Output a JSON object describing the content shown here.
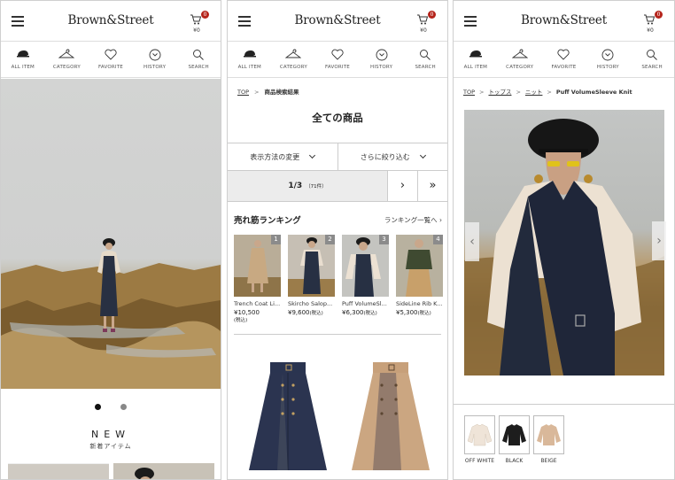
{
  "header": {
    "logo": "Brown&Street",
    "cart_badge": "0",
    "cart_amount": "¥0"
  },
  "icon_nav": [
    {
      "label": "ALL ITEM",
      "icon": "hat-icon"
    },
    {
      "label": "CATEGORY",
      "icon": "hanger-icon"
    },
    {
      "label": "FAVORITE",
      "icon": "heart-icon"
    },
    {
      "label": "HISTORY",
      "icon": "history-icon"
    },
    {
      "label": "SEARCH",
      "icon": "search-icon"
    }
  ],
  "home": {
    "new_title": "NEW",
    "new_subtitle": "新着アイテム",
    "slider_dots": 2,
    "active_dot": 0
  },
  "search": {
    "breadcrumb": [
      "TOP",
      "商品検索結果"
    ],
    "title": "全ての商品",
    "filter_display": "表示方法の変更",
    "filter_narrow": "さらに絞り込む",
    "pager_text": "1/3",
    "pager_count": "（71件）",
    "next": "›",
    "last": "»",
    "ranking_title": "売れ筋ランキング",
    "ranking_link": "ランキング一覧へ ›",
    "ranking": [
      {
        "rank": "1",
        "name": "Trench Coat Li...",
        "price": "¥10,500",
        "tax": "(税込)"
      },
      {
        "rank": "2",
        "name": "Skircho Salop...",
        "price": "¥9,600",
        "tax": "(税込)"
      },
      {
        "rank": "3",
        "name": "Puff VolumeSl...",
        "price": "¥6,300",
        "tax": "(税込)"
      },
      {
        "rank": "4",
        "name": "SideLine Rib K...",
        "price": "¥5,300",
        "tax": "(税込)"
      }
    ]
  },
  "product": {
    "breadcrumb": [
      "TOP",
      "トップス",
      "ニット",
      "Puff VolumeSleeve Knit"
    ],
    "prev": "‹",
    "next": "›",
    "colors": [
      {
        "label": "OFF WHITE",
        "color": "#efe4d8"
      },
      {
        "label": "BLACK",
        "color": "#1d1d1d"
      },
      {
        "label": "BEIGE",
        "color": "#d9b89a"
      }
    ]
  },
  "colors": {
    "accent_badge": "#b5241b",
    "pager_bg": "#ececec"
  }
}
